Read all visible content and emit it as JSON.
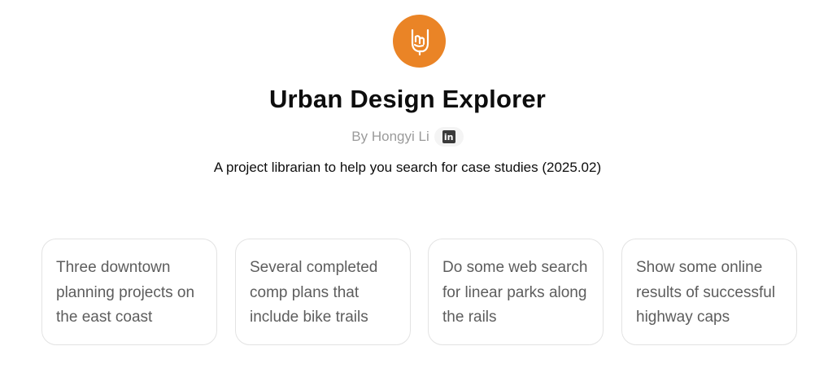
{
  "header": {
    "logo_icon": "rock-hand-icon",
    "logo_color": "#ea8426",
    "title": "Urban Design Explorer",
    "byline": "By Hongyi Li",
    "social_icon": "linkedin-icon",
    "social_icon_text": "in",
    "description": "A project librarian to help you search for case studies (2025.02)"
  },
  "starters": [
    {
      "text": "Three downtown planning projects on the east coast"
    },
    {
      "text": "Several completed comp plans that include bike trails"
    },
    {
      "text": "Do some web search for linear parks along the rails"
    },
    {
      "text": "Show some online results of successful highway caps"
    }
  ]
}
